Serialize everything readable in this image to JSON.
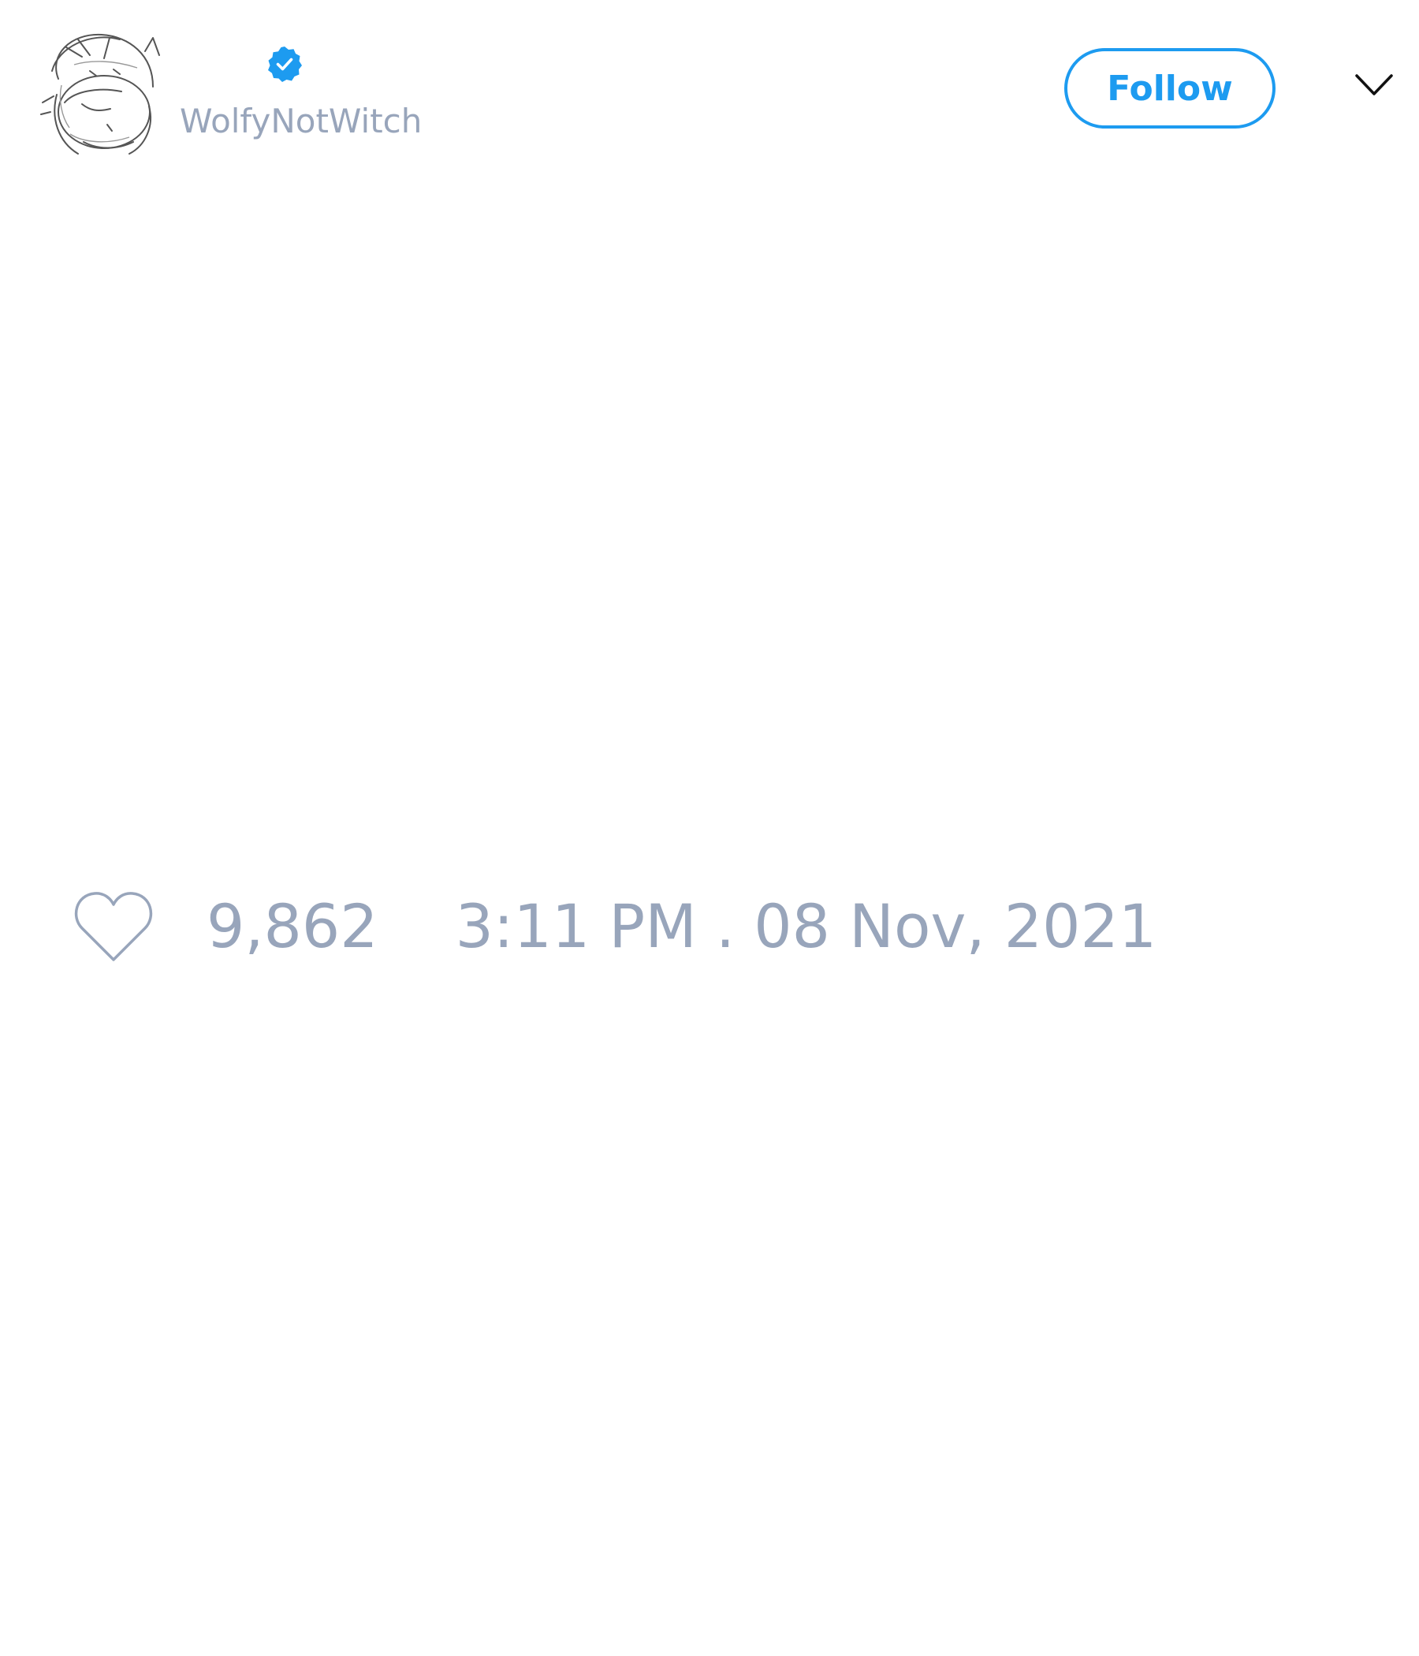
{
  "author": {
    "handle": "WolfyNotWitch",
    "verified": true,
    "avatar_icon": "sketch-avatar-icon",
    "verified_icon": "verified-badge-icon"
  },
  "actions": {
    "follow_label": "Follow",
    "menu_icon": "chevron-down-icon"
  },
  "footer": {
    "like_icon": "heart-icon",
    "like_count": "9,862",
    "timestamp": "3:11 PM . 08 Nov, 2021"
  },
  "colors": {
    "accent": "#1d9bf0",
    "muted_text": "#98a5bb",
    "icon_dark": "#111111",
    "background": "#ffffff"
  }
}
